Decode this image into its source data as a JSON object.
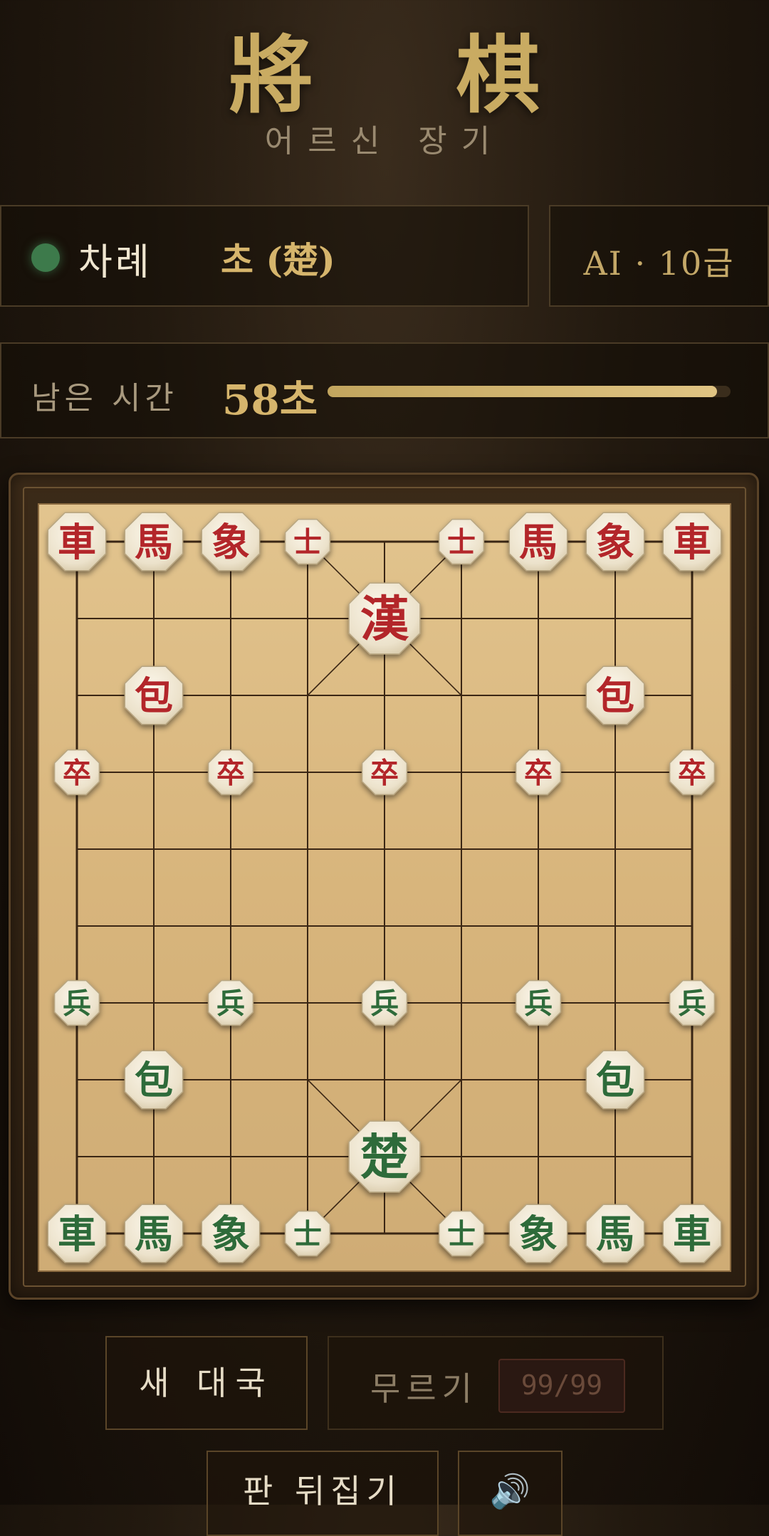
{
  "header": {
    "title": "將 棋",
    "subtitle": "어르신 장기"
  },
  "status": {
    "turn_label": "차례",
    "turn_value": "초 (楚)",
    "ai_level": "AI · 10급",
    "timer_label": "남은 시간",
    "timer_value": "58초",
    "timer_fraction": 0.967
  },
  "colors": {
    "accent": "#d6b56c",
    "red_piece": "#b3262a",
    "green_piece": "#2e6b3a",
    "board": "#e0c08a"
  },
  "board": {
    "files": 9,
    "ranks": 10,
    "pieces": [
      {
        "char": "車",
        "side": "red",
        "file": 0,
        "rank": 0,
        "size": "large"
      },
      {
        "char": "馬",
        "side": "red",
        "file": 1,
        "rank": 0,
        "size": "large"
      },
      {
        "char": "象",
        "side": "red",
        "file": 2,
        "rank": 0,
        "size": "large"
      },
      {
        "char": "士",
        "side": "red",
        "file": 3,
        "rank": 0,
        "size": "small"
      },
      {
        "char": "士",
        "side": "red",
        "file": 5,
        "rank": 0,
        "size": "small"
      },
      {
        "char": "馬",
        "side": "red",
        "file": 6,
        "rank": 0,
        "size": "large"
      },
      {
        "char": "象",
        "side": "red",
        "file": 7,
        "rank": 0,
        "size": "large"
      },
      {
        "char": "車",
        "side": "red",
        "file": 8,
        "rank": 0,
        "size": "large"
      },
      {
        "char": "漢",
        "side": "red",
        "file": 4,
        "rank": 1,
        "size": "king"
      },
      {
        "char": "包",
        "side": "red",
        "file": 1,
        "rank": 2,
        "size": "large"
      },
      {
        "char": "包",
        "side": "red",
        "file": 7,
        "rank": 2,
        "size": "large"
      },
      {
        "char": "卒",
        "side": "red",
        "file": 0,
        "rank": 3,
        "size": "small"
      },
      {
        "char": "卒",
        "side": "red",
        "file": 2,
        "rank": 3,
        "size": "small"
      },
      {
        "char": "卒",
        "side": "red",
        "file": 4,
        "rank": 3,
        "size": "small"
      },
      {
        "char": "卒",
        "side": "red",
        "file": 6,
        "rank": 3,
        "size": "small"
      },
      {
        "char": "卒",
        "side": "red",
        "file": 8,
        "rank": 3,
        "size": "small"
      },
      {
        "char": "兵",
        "side": "green",
        "file": 0,
        "rank": 6,
        "size": "small"
      },
      {
        "char": "兵",
        "side": "green",
        "file": 2,
        "rank": 6,
        "size": "small"
      },
      {
        "char": "兵",
        "side": "green",
        "file": 4,
        "rank": 6,
        "size": "small"
      },
      {
        "char": "兵",
        "side": "green",
        "file": 6,
        "rank": 6,
        "size": "small"
      },
      {
        "char": "兵",
        "side": "green",
        "file": 8,
        "rank": 6,
        "size": "small"
      },
      {
        "char": "包",
        "side": "green",
        "file": 1,
        "rank": 7,
        "size": "large"
      },
      {
        "char": "包",
        "side": "green",
        "file": 7,
        "rank": 7,
        "size": "large"
      },
      {
        "char": "楚",
        "side": "green",
        "file": 4,
        "rank": 8,
        "size": "king"
      },
      {
        "char": "車",
        "side": "green",
        "file": 0,
        "rank": 9,
        "size": "large"
      },
      {
        "char": "馬",
        "side": "green",
        "file": 1,
        "rank": 9,
        "size": "large"
      },
      {
        "char": "象",
        "side": "green",
        "file": 2,
        "rank": 9,
        "size": "large"
      },
      {
        "char": "士",
        "side": "green",
        "file": 3,
        "rank": 9,
        "size": "small"
      },
      {
        "char": "士",
        "side": "green",
        "file": 5,
        "rank": 9,
        "size": "small"
      },
      {
        "char": "象",
        "side": "green",
        "file": 6,
        "rank": 9,
        "size": "large"
      },
      {
        "char": "馬",
        "side": "green",
        "file": 7,
        "rank": 9,
        "size": "large"
      },
      {
        "char": "車",
        "side": "green",
        "file": 8,
        "rank": 9,
        "size": "large"
      }
    ]
  },
  "controls": {
    "new_game": "새 대국",
    "undo": "무르기",
    "undo_count": "99/99",
    "flip_board": "판 뒤집기",
    "sound_icon": "🔊"
  }
}
